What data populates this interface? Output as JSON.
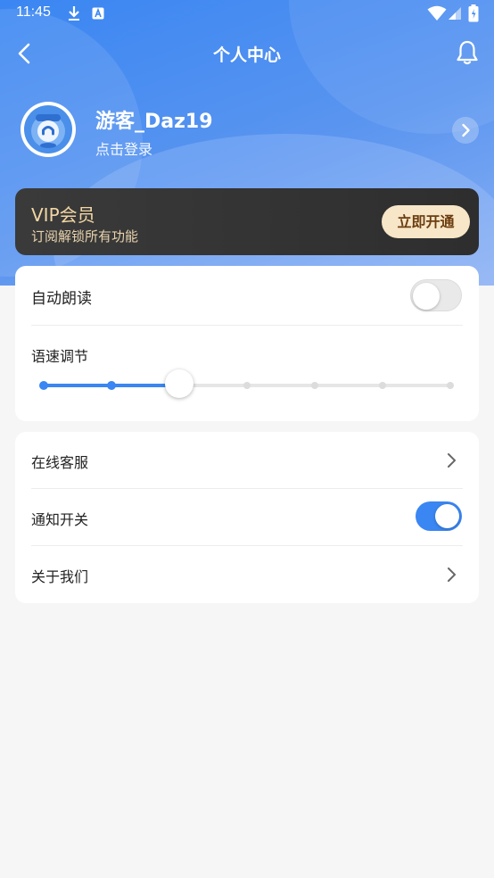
{
  "status_bar": {
    "time": "11:45",
    "icons": [
      "download-icon",
      "app-a-icon",
      "wifi-icon",
      "signal-icon",
      "battery-icon"
    ]
  },
  "nav": {
    "title": "个人中心",
    "back_icon": "chevron-left-icon",
    "bell_icon": "bell-icon"
  },
  "profile": {
    "username": "游客_Daz19",
    "login_hint": "点击登录"
  },
  "vip": {
    "title": "VIP会员",
    "subtitle": "订阅解锁所有功能",
    "button": "立即开通"
  },
  "settings": {
    "auto_read": {
      "label": "自动朗读",
      "enabled": false
    },
    "speed": {
      "label": "语速调节",
      "steps": 7,
      "selected_index": 2
    },
    "service": {
      "label": "在线客服"
    },
    "notification": {
      "label": "通知开关",
      "enabled": true
    },
    "about": {
      "label": "关于我们"
    }
  },
  "colors": {
    "accent": "#3a86f2",
    "vip_gold": "#f2d6a4",
    "vip_button_bg": "#f7e6c7",
    "background": "#f6f6f6"
  }
}
